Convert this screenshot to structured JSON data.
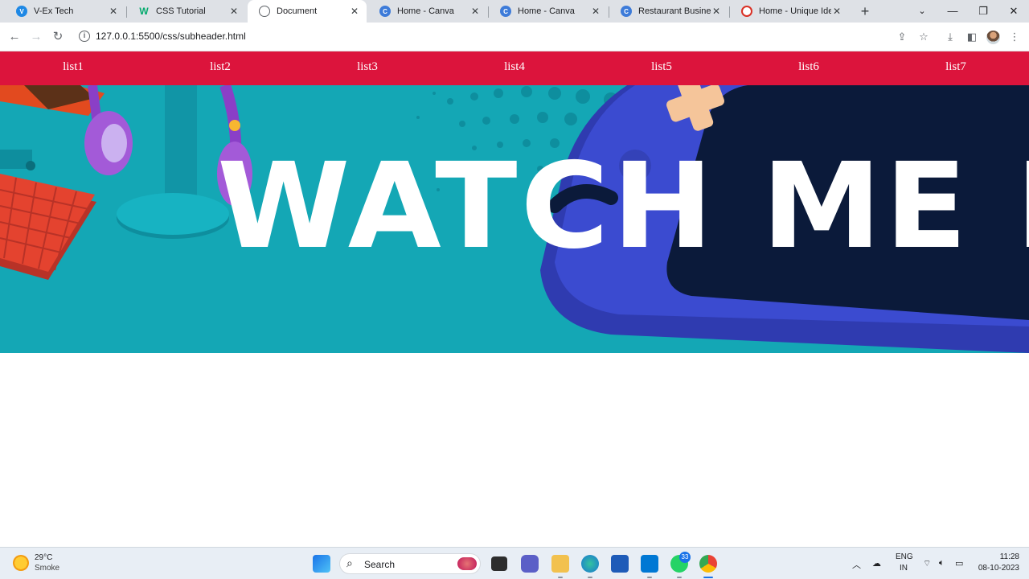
{
  "browser": {
    "tabs": [
      {
        "title": "V-Ex Tech",
        "favicon": "vex-icon",
        "color": "#1e88e5"
      },
      {
        "title": "CSS Tutorial",
        "favicon": "w3schools-icon",
        "color": "#04aa6d"
      },
      {
        "title": "Document",
        "favicon": "globe-icon",
        "color": "#5f6368",
        "active": true
      },
      {
        "title": "Home - Canva",
        "favicon": "canva-icon",
        "color": "#3d7bd9"
      },
      {
        "title": "Home - Canva",
        "favicon": "canva-icon",
        "color": "#3d7bd9"
      },
      {
        "title": "Restaurant Business F",
        "favicon": "canva-icon",
        "color": "#3d7bd9"
      },
      {
        "title": "Home - Unique Ident",
        "favicon": "aadhaar-icon",
        "color": "#d93025"
      }
    ],
    "url": "127.0.0.1:5500/css/subheader.html"
  },
  "page": {
    "nav_items": [
      "list1",
      "list2",
      "list3",
      "list4",
      "list5",
      "list6",
      "list7"
    ],
    "banner_title": "WATCH ME LIVE",
    "colors": {
      "subheader_bg": "#dc143c",
      "banner_bg": "#14a7b5",
      "console_blue": "#3b4bd0",
      "console_screen": "#0b1a3a"
    }
  },
  "taskbar": {
    "weather": {
      "temp": "29°C",
      "desc": "Smoke"
    },
    "search_label": "Search",
    "whatsapp_badge": "33",
    "language": {
      "line1": "ENG",
      "line2": "IN"
    },
    "clock": {
      "time": "11:28",
      "date": "08-10-2023"
    }
  }
}
